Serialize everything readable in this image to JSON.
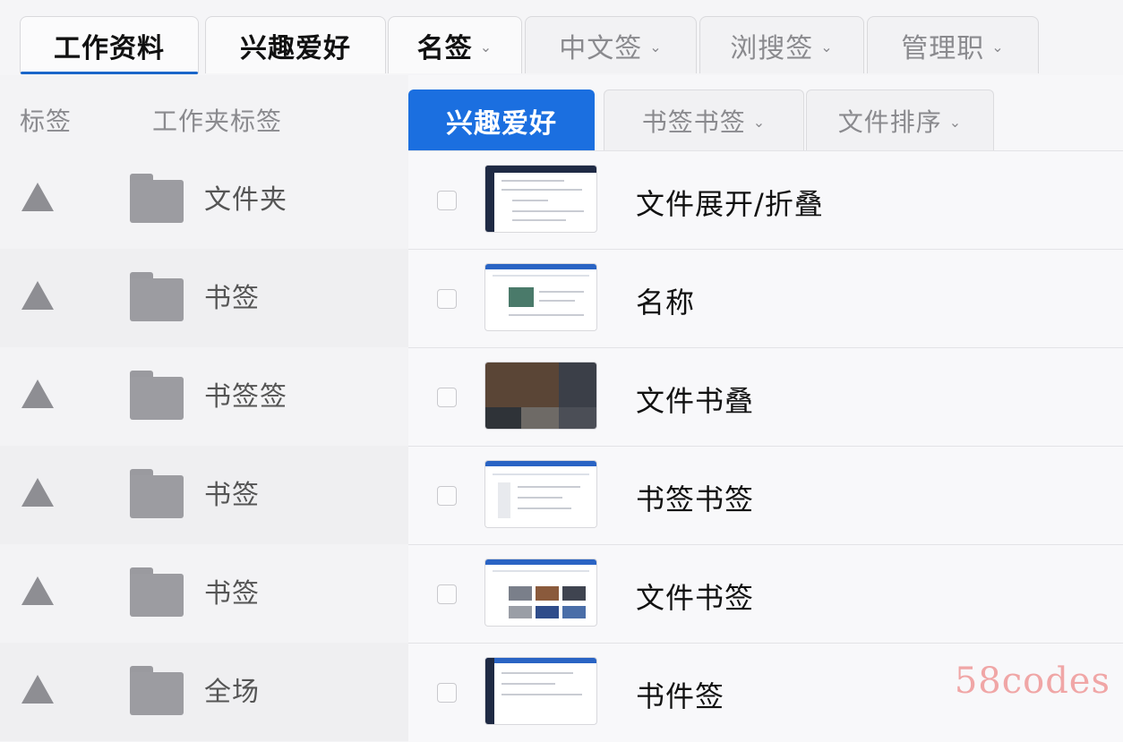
{
  "top_tabs": [
    {
      "label": "工作资料",
      "caret": ""
    },
    {
      "label": "兴趣爱好",
      "caret": ""
    },
    {
      "label": "名签",
      "caret": "⌄"
    },
    {
      "label": "中文签",
      "caret": "⌄"
    },
    {
      "label": "浏搜签",
      "caret": "⌄"
    },
    {
      "label": "管理职",
      "caret": "⌄"
    }
  ],
  "left_panel": {
    "header_tag": "标签",
    "header_folder": "工作夹标签",
    "items": [
      {
        "label": "文件夹"
      },
      {
        "label": "书签"
      },
      {
        "label": "书签签"
      },
      {
        "label": "书签"
      },
      {
        "label": "书签"
      },
      {
        "label": "全场"
      }
    ]
  },
  "sub_tabs": [
    {
      "label": "兴趣爱好",
      "caret": ""
    },
    {
      "label": "书签书签",
      "caret": "⌄"
    },
    {
      "label": "文件排序",
      "caret": "⌄"
    }
  ],
  "list_items": [
    {
      "title": "文件展开/折叠"
    },
    {
      "title": "名称"
    },
    {
      "title": "文件书叠"
    },
    {
      "title": "书签书签"
    },
    {
      "title": "文件书签"
    },
    {
      "title": "书件签"
    }
  ],
  "colors": {
    "accent": "#1b6fe0",
    "folder": "#9c9ca1",
    "triangle": "#8e8e93"
  },
  "watermark": "58codes"
}
